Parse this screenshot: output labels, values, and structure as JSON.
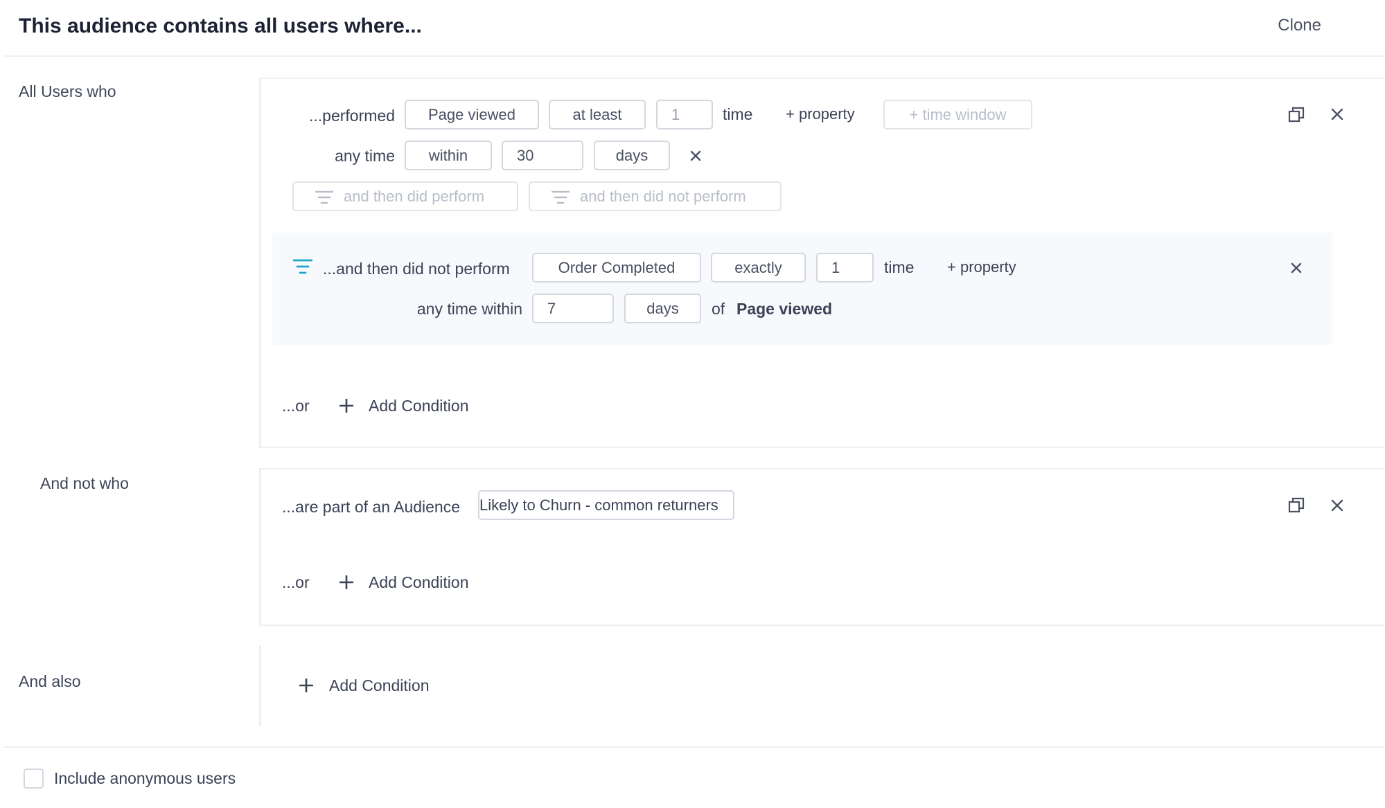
{
  "header": {
    "title": "This audience contains all users where...",
    "clone_label": "Clone"
  },
  "section1": {
    "label": "All Users who",
    "row1": {
      "label": "...performed",
      "event": "Page viewed",
      "operator": "at least",
      "count": "1",
      "unit": "time",
      "add_property": "+ property",
      "add_time_window": "+ time window"
    },
    "row2": {
      "label": "any time",
      "mode": "within",
      "value": "30",
      "unit": "days"
    },
    "funnel_buttons": {
      "did_perform": "and then did perform",
      "did_not_perform": "and then did not perform"
    },
    "sub": {
      "label": "...and then did not perform",
      "event": "Order Completed",
      "operator": "exactly",
      "count": "1",
      "unit": "time",
      "add_property": "+ property",
      "within_label": "any time within",
      "within_value": "7",
      "within_unit": "days",
      "of_label": "of",
      "of_event": "Page viewed"
    },
    "or_label": "...or",
    "add_condition": "Add Condition"
  },
  "section2": {
    "label": "And not who",
    "row_label": "...are part of an Audience",
    "audience": "Likely to Churn - common returners",
    "or_label": "...or",
    "add_condition": "Add Condition"
  },
  "section3": {
    "label": "And also",
    "add_condition": "Add Condition"
  },
  "footer": {
    "include_anonymous": "Include anonymous users",
    "include_anonymous_checked": false
  },
  "colors": {
    "accent": "#1aa7c9",
    "text": "#3b4256",
    "muted": "#b8bdc8",
    "border": "#d3d7df"
  }
}
